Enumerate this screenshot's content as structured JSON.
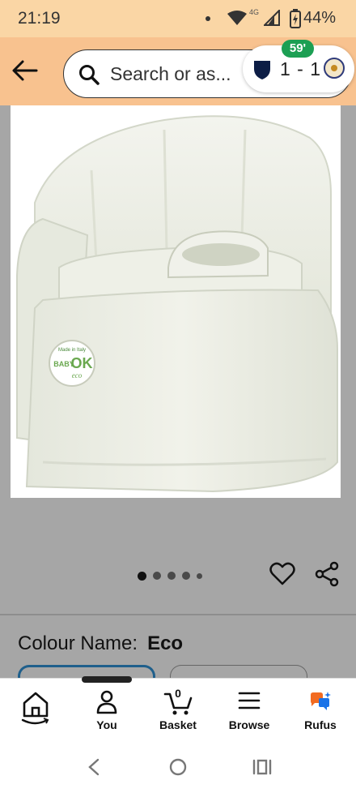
{
  "status_bar": {
    "time": "21:19",
    "network": "4G",
    "battery": "44%"
  },
  "header": {
    "search_placeholder": "Search or as...",
    "score": "1 - 1",
    "minute": "59'"
  },
  "product_image": {
    "badge_line1": "Made in Italy",
    "badge_brand": "OK",
    "badge_baby": "BABY",
    "badge_eco": "eco"
  },
  "carousel": {
    "dots": 5,
    "active_index": 0
  },
  "variant": {
    "label": "Colour Name:",
    "value": "Eco"
  },
  "bottom_nav": {
    "items": [
      {
        "label": "",
        "icon": "home-icon"
      },
      {
        "label": "You",
        "icon": "person-icon"
      },
      {
        "label": "Basket",
        "icon": "cart-icon",
        "count": "0"
      },
      {
        "label": "Browse",
        "icon": "menu-icon"
      },
      {
        "label": "Rufus",
        "icon": "rufus-icon"
      }
    ]
  },
  "colors": {
    "header_bg": "#f8c28f",
    "status_bg": "#fad6a5",
    "overlay_grey": "#a6a6a6",
    "score_green": "#1c9f53",
    "selected_swatch": "#1f5f8b"
  }
}
